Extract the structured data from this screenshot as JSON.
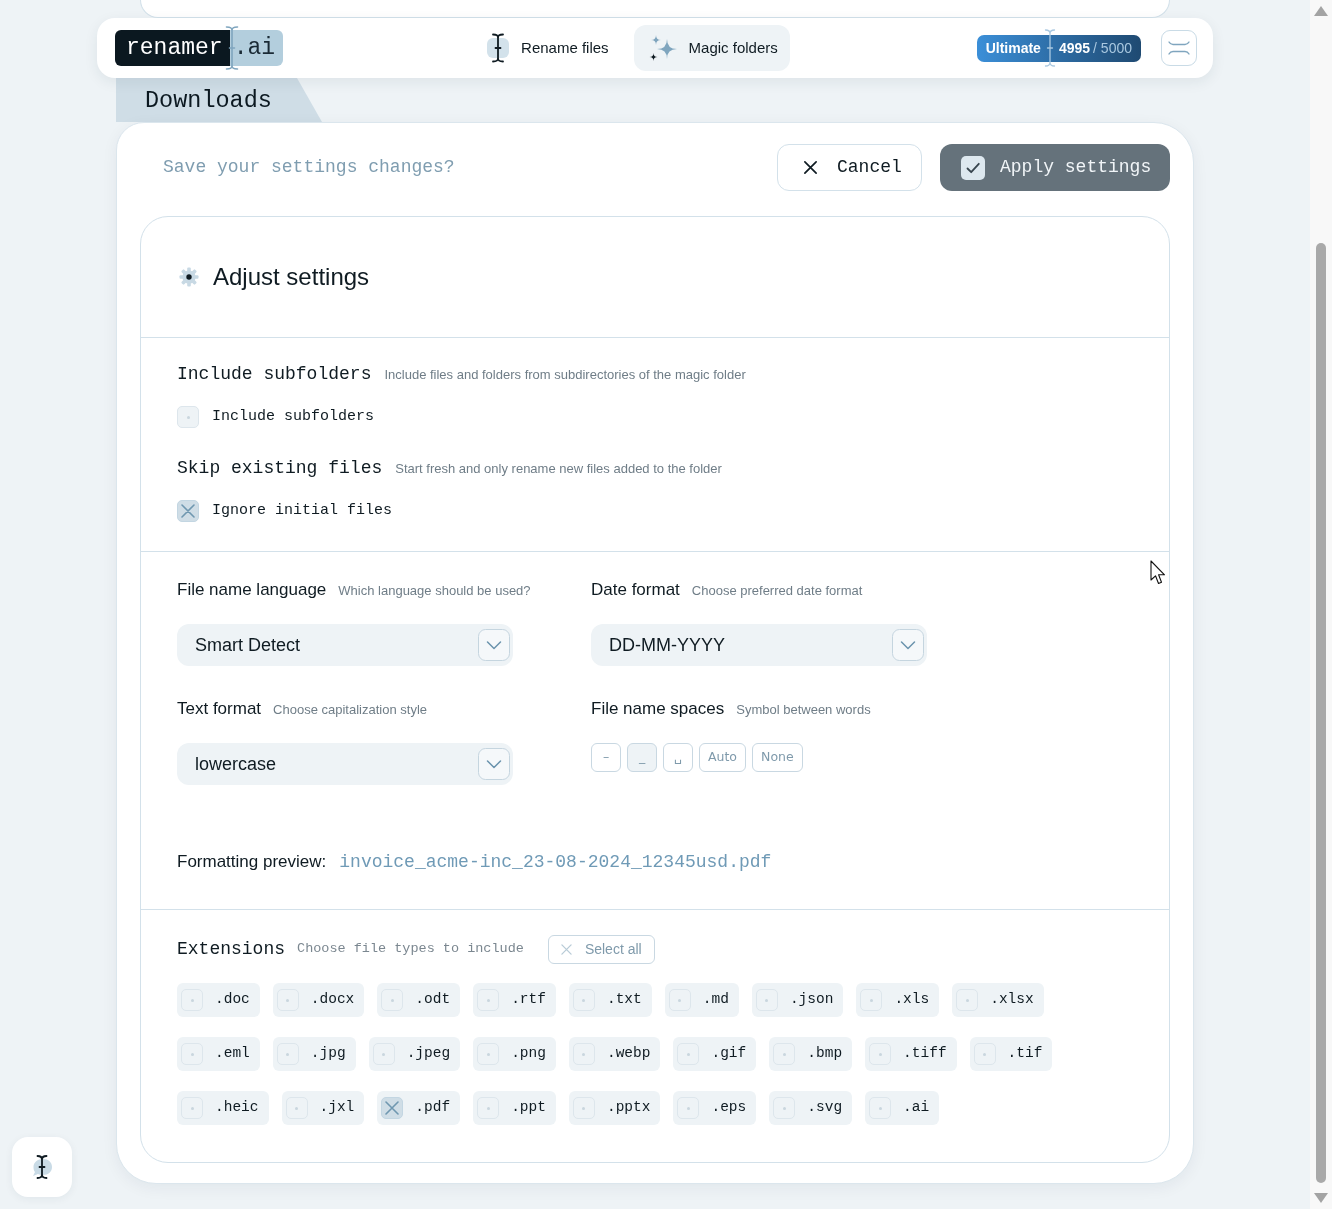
{
  "top_bar": {
    "logo": {
      "name": "renamer",
      "suffix": ".ai"
    },
    "nav": [
      {
        "label": "Rename files",
        "selected": false
      },
      {
        "label": "Magic folders",
        "selected": true
      }
    ],
    "plan": {
      "name": "Ultimate",
      "used": "4995",
      "limit": "/ 5000"
    }
  },
  "folder_tab": {
    "label": "Downloads"
  },
  "save_bar": {
    "question": "Save your settings changes?",
    "buttons": [
      {
        "label": "Cancel",
        "kind": "cancel"
      },
      {
        "label": "Apply settings",
        "kind": "apply"
      }
    ]
  },
  "settings": {
    "title": "Adjust settings",
    "options": [
      {
        "title": "Include subfolders",
        "hint": "Include files and folders from subdirectories of the magic folder",
        "checkbox": {
          "label": "Include subfolders",
          "checked": false
        }
      },
      {
        "title": "Skip existing files",
        "hint": "Start fresh and only rename new files added to the folder",
        "checkbox": {
          "label": "Ignore initial files",
          "checked": true
        }
      }
    ],
    "formatting": [
      {
        "kind": "select",
        "label": "File name language",
        "hint": "Which language should be used?",
        "value": "Smart Detect"
      },
      {
        "kind": "select",
        "label": "Date format",
        "hint": "Choose preferred date format",
        "value": "DD-MM-YYYY"
      },
      {
        "kind": "select",
        "label": "Text format",
        "hint": "Choose capitalization style",
        "value": "lowercase"
      },
      {
        "kind": "choices",
        "label": "File name spaces",
        "hint": "Symbol between words",
        "choices": [
          {
            "label": "–",
            "selected": false
          },
          {
            "label": "_",
            "selected": true
          },
          {
            "label": "␣",
            "selected": false
          },
          {
            "label": "Auto",
            "selected": false
          },
          {
            "label": "None",
            "selected": false
          }
        ]
      }
    ],
    "preview": {
      "label": "Formatting preview:",
      "value": "invoice_acme-inc_23-08-2024_12345usd.pdf"
    },
    "extensions": {
      "title": "Extensions",
      "hint": "Choose file types to include",
      "select_all": "Select all",
      "items": [
        {
          "label": ".doc",
          "checked": false
        },
        {
          "label": ".docx",
          "checked": false
        },
        {
          "label": ".odt",
          "checked": false
        },
        {
          "label": ".rtf",
          "checked": false
        },
        {
          "label": ".txt",
          "checked": false
        },
        {
          "label": ".md",
          "checked": false
        },
        {
          "label": ".json",
          "checked": false
        },
        {
          "label": ".xls",
          "checked": false
        },
        {
          "label": ".xlsx",
          "checked": false
        },
        {
          "label": ".eml",
          "checked": false
        },
        {
          "label": ".jpg",
          "checked": false
        },
        {
          "label": ".jpeg",
          "checked": false
        },
        {
          "label": ".png",
          "checked": false
        },
        {
          "label": ".webp",
          "checked": false
        },
        {
          "label": ".gif",
          "checked": false
        },
        {
          "label": ".bmp",
          "checked": false
        },
        {
          "label": ".tiff",
          "checked": false
        },
        {
          "label": ".tif",
          "checked": false
        },
        {
          "label": ".heic",
          "checked": false
        },
        {
          "label": ".jxl",
          "checked": false
        },
        {
          "label": ".pdf",
          "checked": true
        },
        {
          "label": ".ppt",
          "checked": false
        },
        {
          "label": ".pptx",
          "checked": false
        },
        {
          "label": ".eps",
          "checked": false
        },
        {
          "label": ".svg",
          "checked": false
        },
        {
          "label": ".ai",
          "checked": false
        }
      ]
    }
  }
}
